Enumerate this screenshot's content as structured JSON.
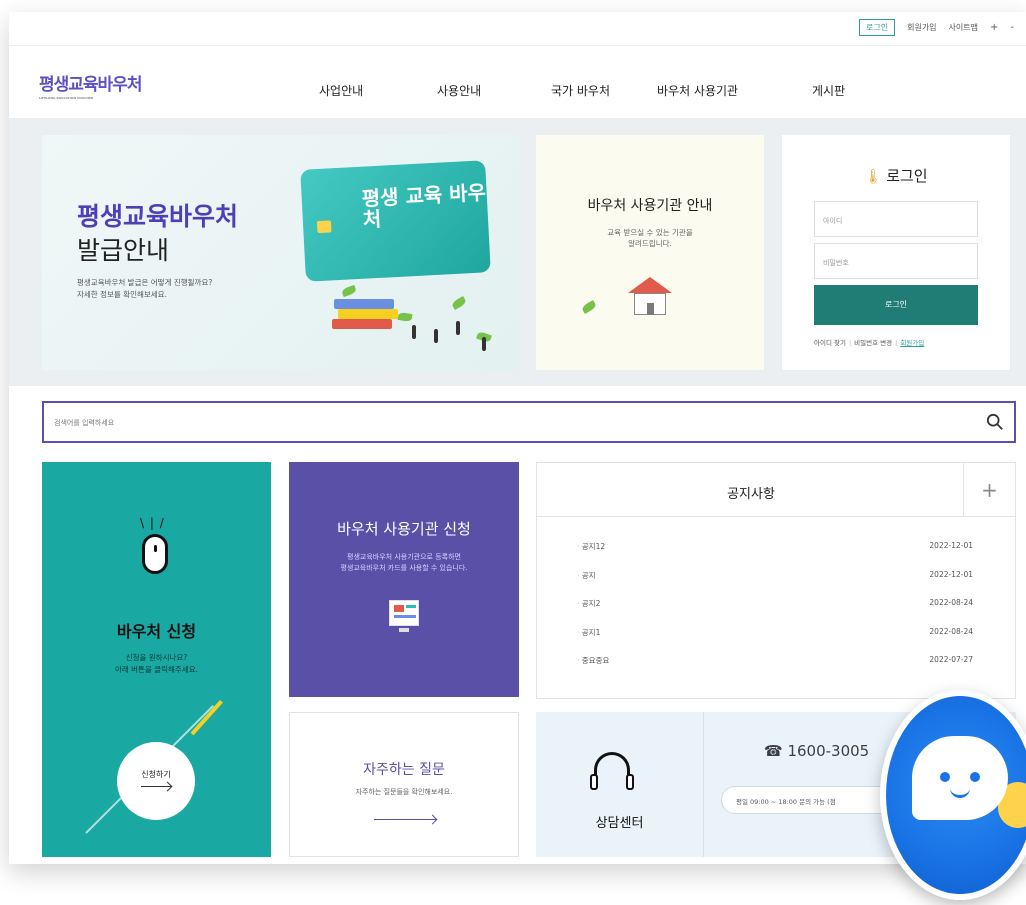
{
  "util": {
    "login": "로그인",
    "join": "회원가입",
    "sitemap": "사이트맵",
    "plus": "+",
    "dash": "-"
  },
  "logo": {
    "title": "평생교육바우처",
    "sub": "LIFELONG EDUCATION VOUCHER"
  },
  "nav": [
    "사업안내",
    "사용안내",
    "국가 바우처",
    "바우처 사용기관",
    "게시판"
  ],
  "banner": {
    "title": "평생교육바우처",
    "subtitle": "발급안내",
    "desc1": "평생교육바우처 발급은 어떻게 진행될까요?",
    "desc2": "자세한 정보를 확인해보세요.",
    "card_text": "평생 교육 바우처"
  },
  "place": {
    "title": "바우처 사용기관 안내",
    "desc1": "교육 받으실 수 있는 기관을",
    "desc2": "알려드립니다."
  },
  "login_panel": {
    "title": "로그인",
    "id_placeholder": "아이디",
    "pw_placeholder": "비밀번호",
    "button": "로그인",
    "find_id": "아이디 찾기",
    "change_pw": "비밀번호 변경",
    "join": "회원가입"
  },
  "search": {
    "placeholder": "검색어를 입력하세요"
  },
  "apply": {
    "title": "바우처 신청",
    "desc1": "신청을 원하시나요?",
    "desc2": "아래 버튼을 클릭해주세요.",
    "button": "신청하기"
  },
  "agency": {
    "title": "바우처 사용기관 신청",
    "desc1": "평생교육바우처 사용기관으로 등록하면",
    "desc2": "평생교육바우처 카드를 사용할 수 있습니다."
  },
  "notice": {
    "title": "공지사항",
    "plus": "+",
    "items": [
      {
        "title": "공지12",
        "date": "2022-12-01"
      },
      {
        "title": "공지",
        "date": "2022-12-01"
      },
      {
        "title": "공지2",
        "date": "2022-08-24"
      },
      {
        "title": "공지1",
        "date": "2022-08-24"
      },
      {
        "title": "중요중요",
        "date": "2022-07-27"
      }
    ]
  },
  "faq": {
    "title": "자주하는 질문",
    "desc": "자주하는 질문들을 확인해보세요."
  },
  "center": {
    "title": "상담센터",
    "phone": "☎ 1600-3005",
    "hours": "평일 09:00 ~ 18:00 문의 가능 (점"
  },
  "colors": {
    "teal": "#19a8a2",
    "purple": "#5b50a8",
    "login_green": "#1f7d76",
    "chatbot_blue": "#1a74e6"
  }
}
